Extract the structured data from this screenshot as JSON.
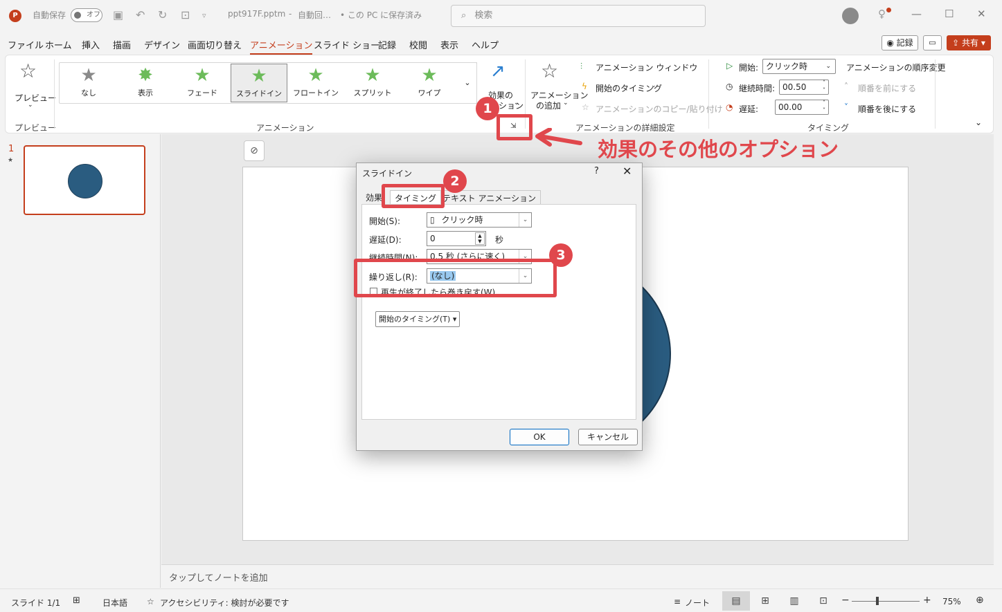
{
  "titlebar": {
    "logo": "P",
    "autosave_label": "自動保存",
    "autosave_state": "オフ",
    "filename": "ppt917F.pptm",
    "status_separator": "-",
    "status1": "自動回…",
    "status2": "• この PC に保存済み",
    "search_placeholder": "検索"
  },
  "menu": {
    "tabs": [
      "ファイル",
      "ホーム",
      "挿入",
      "描画",
      "デザイン",
      "画面切り替え",
      "アニメーション",
      "スライド ショー",
      "記録",
      "校閲",
      "表示",
      "ヘルプ"
    ],
    "record_button": "記録",
    "share_button": "共有"
  },
  "ribbon": {
    "preview_label": "プレビュー",
    "preview_group": "プレビュー",
    "gallery": [
      "なし",
      "表示",
      "フェード",
      "スライドイン",
      "フロートイン",
      "スプリット",
      "ワイプ"
    ],
    "effect_options_line1": "効果の",
    "effect_options_line2": "ション",
    "animation_group": "アニメーション",
    "add_animation_line1": "アニメーション",
    "add_animation_line2": "の追加",
    "animation_pane": "アニメーション ウィンドウ",
    "trigger": "開始のタイミング",
    "animation_painter": "アニメーションのコピー/貼り付け",
    "advanced_group": "アニメーションの詳細設定",
    "start_label": "開始:",
    "start_value": "クリック時",
    "duration_label": "継続時間:",
    "duration_value": "00.50",
    "delay_label": "遅延:",
    "delay_value": "00.00",
    "reorder_title": "アニメーションの順序変更",
    "move_earlier": "順番を前にする",
    "move_later": "順番を後にする",
    "timing_group": "タイミング"
  },
  "slides": {
    "number": "1",
    "star": "★"
  },
  "notes_placeholder": "タップしてノートを追加",
  "statusbar": {
    "slide_count": "スライド 1/1",
    "language": "日本語",
    "accessibility": "アクセシビリティ: 検討が必要です",
    "notes": "ノート",
    "zoom": "75%"
  },
  "dialog": {
    "title": "スライドイン",
    "help": "?",
    "tabs": [
      "効果",
      "タイミング",
      "テキスト アニメーション"
    ],
    "start_label": "開始(S):",
    "start_value": "クリック時",
    "delay_label": "遅延(D):",
    "delay_value": "0",
    "delay_unit": "秒",
    "duration_label": "継続時間(N):",
    "duration_value": "0.5 秒 (さらに速く)",
    "repeat_label": "繰り返し(R):",
    "repeat_value": "(なし)",
    "rewind_label": "再生が終了したら巻き戻す(W)",
    "trigger_button": "開始のタイミング(T)",
    "ok": "OK",
    "cancel": "キャンセル"
  },
  "annotations": {
    "badge1": "1",
    "badge2": "2",
    "badge3": "3",
    "callout": "効果のその他のオプション",
    "color": "#e0474c"
  },
  "colors": {
    "accent": "#c43e1c",
    "shape_fill": "#2a5c80"
  }
}
